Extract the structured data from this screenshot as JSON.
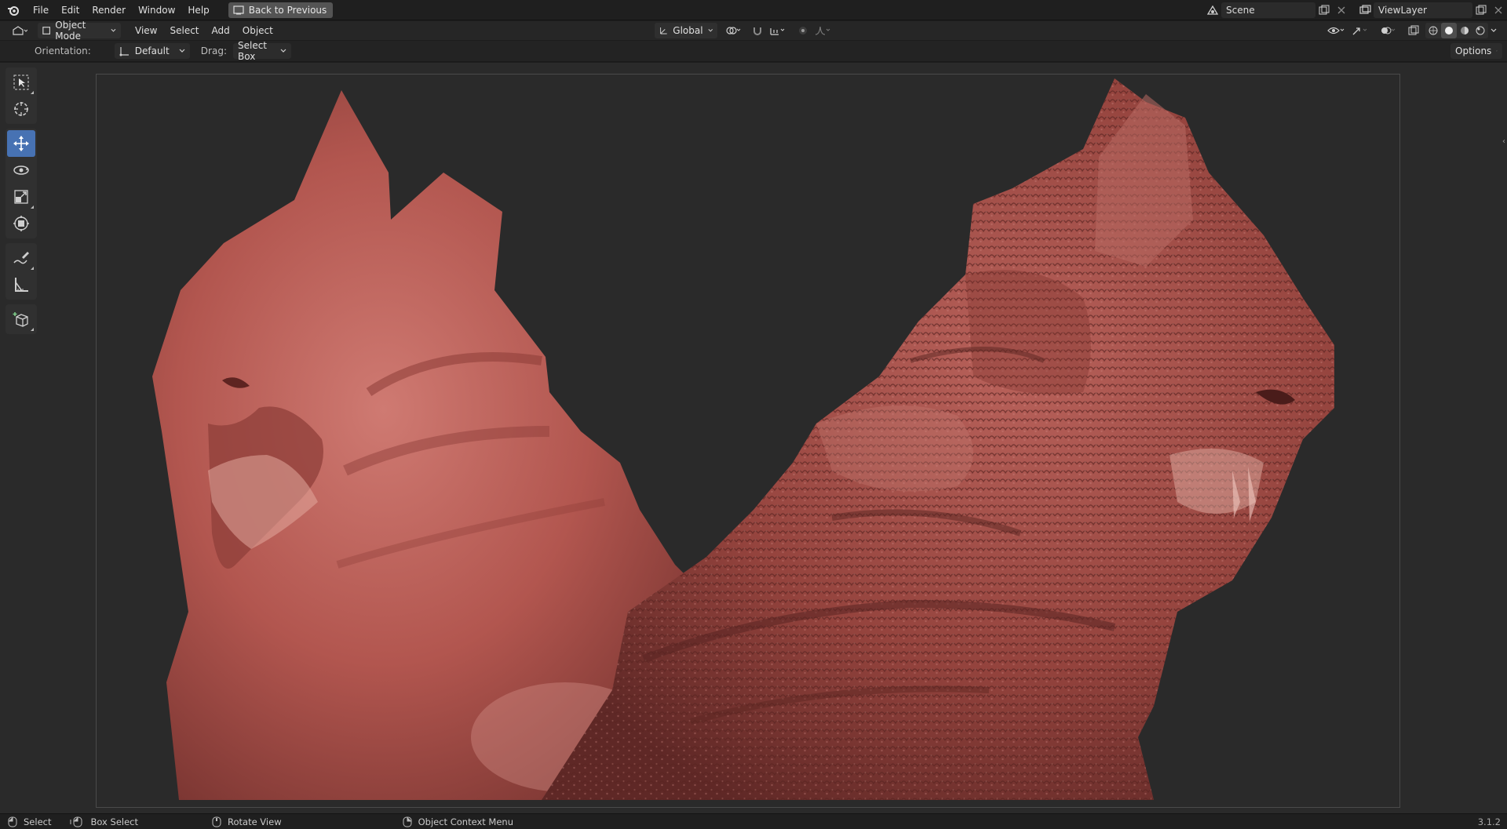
{
  "menubar": {
    "items": [
      "File",
      "Edit",
      "Render",
      "Window",
      "Help"
    ],
    "back_button": "Back to Previous",
    "scene_name": "Scene",
    "view_layer": "ViewLayer"
  },
  "header": {
    "mode": "Object Mode",
    "menus": [
      "View",
      "Select",
      "Add",
      "Object"
    ],
    "transform_orientation": "Global"
  },
  "tool_settings": {
    "orientation_label": "Orientation:",
    "orientation_value": "Default",
    "drag_label": "Drag:",
    "drag_value": "Select Box",
    "options_label": "Options"
  },
  "toolbar": {
    "tools": [
      "select-box-tool",
      "cursor-tool",
      "move-tool",
      "rotate-tool",
      "scale-tool",
      "transform-tool",
      "annotate-tool",
      "measure-tool",
      "add-cube-tool"
    ],
    "active_tool": "move-tool"
  },
  "statusbar": {
    "items": [
      "Select",
      "Box Select",
      "Rotate View",
      "Object Context Menu"
    ],
    "version": "3.1.2"
  },
  "colors": {
    "accent": "#4772b3",
    "sculpt_surface": "#b85c58",
    "viewport_bg": "#2a2a2a"
  }
}
